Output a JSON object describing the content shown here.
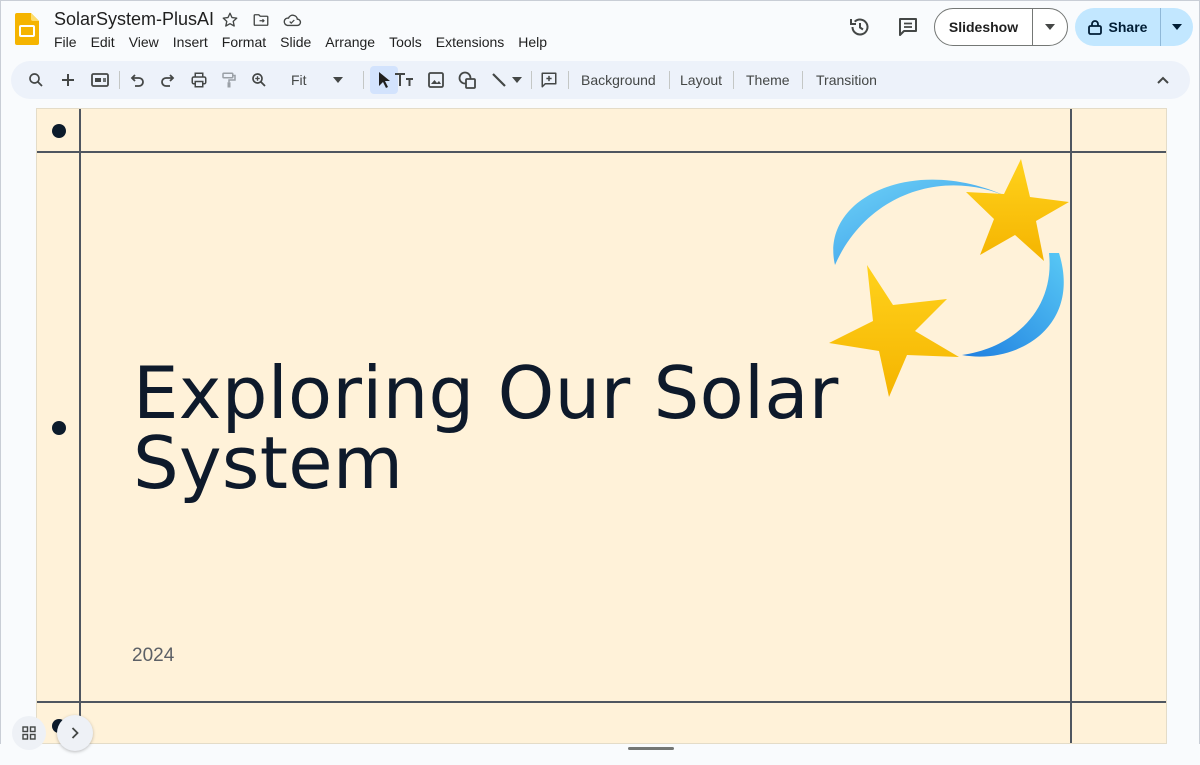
{
  "app": {
    "doc_title": "SolarSystem-PlusAI",
    "icons": [
      "slides-logo-icon",
      "star-icon",
      "move-to-folder-icon",
      "cloud-saved-icon"
    ]
  },
  "menu": [
    "File",
    "Edit",
    "View",
    "Insert",
    "Format",
    "Slide",
    "Arrange",
    "Tools",
    "Extensions",
    "Help"
  ],
  "header_actions": {
    "history_icon": "version-history-icon",
    "comments_icon": "comments-icon",
    "slideshow_label": "Slideshow",
    "share_label": "Share"
  },
  "toolbar": {
    "zoom_value": "Fit",
    "background_label": "Background",
    "layout_label": "Layout",
    "theme_label": "Theme",
    "transition_label": "Transition"
  },
  "slide": {
    "title": "Exploring Our Solar System",
    "year": "2024",
    "background_color": "#fff2d9",
    "graphic": "two-shooting-stars-icon"
  },
  "colors": {
    "accent_blue": "#c2e7ff",
    "toolbar_bg": "#edf2fa",
    "star_yellow": "#f9c400",
    "orbit_blue": "#3ab0f0"
  }
}
